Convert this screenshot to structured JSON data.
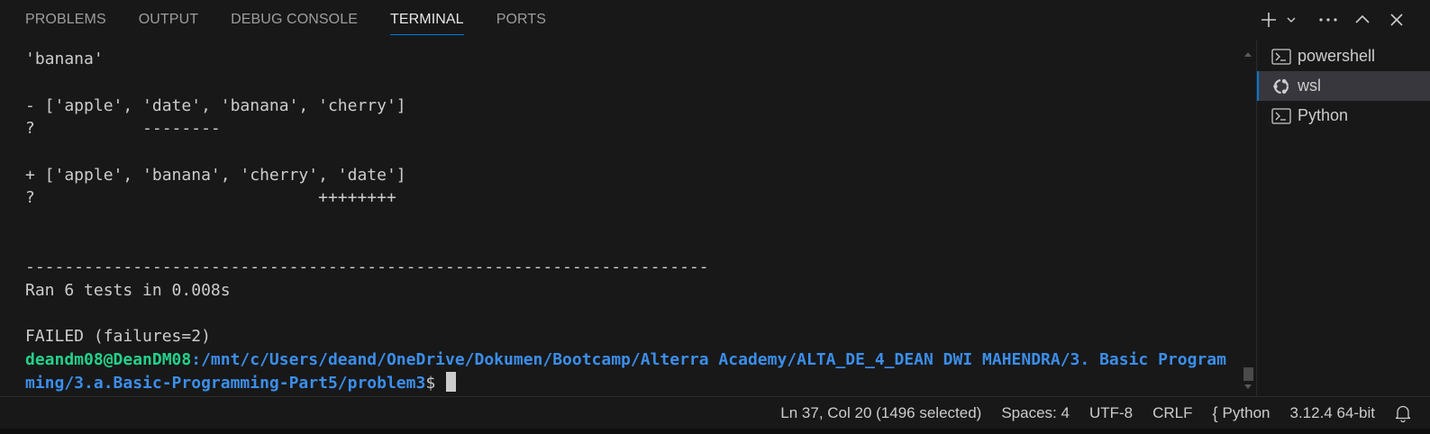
{
  "tabs": [
    {
      "label": "PROBLEMS"
    },
    {
      "label": "OUTPUT"
    },
    {
      "label": "DEBUG CONSOLE"
    },
    {
      "label": "TERMINAL"
    },
    {
      "label": "PORTS"
    }
  ],
  "header_actions": [
    "add-icon",
    "chevron-down-icon",
    "more-icon",
    "chevron-up-icon",
    "close-icon"
  ],
  "terminal": {
    "lines": [
      "'banana'",
      "",
      "- ['apple', 'date', 'banana', 'cherry']",
      "?           --------",
      "",
      "+ ['apple', 'banana', 'cherry', 'date']",
      "?                             ++++++++",
      "",
      "",
      "----------------------------------------------------------------------",
      "Ran 6 tests in 0.008s",
      "",
      "FAILED (failures=2)"
    ],
    "prompt_user": "deandm08@DeanDM08",
    "prompt_path_1": ":/mnt/c/Users/deand/OneDrive/Dokumen/Bootcamp/Alterra Academy/ALTA_DE_4_DEAN DWI MAHENDRA/3. Basic Program",
    "prompt_path_2": "ming/3.a.Basic-Programming-Part5/problem3",
    "prompt_symbol": "$ "
  },
  "terminal_list": [
    {
      "label": "powershell",
      "icon": "terminal-icon"
    },
    {
      "label": "wsl",
      "icon": "linux-icon"
    },
    {
      "label": "Python",
      "icon": "terminal-icon"
    }
  ],
  "status_bar": {
    "position": "Ln 37, Col 20 (1496 selected)",
    "spaces": "Spaces: 4",
    "encoding": "UTF-8",
    "eol": "CRLF",
    "language_braces": "{",
    "language": "Python",
    "interpreter": "3.12.4 64-bit"
  },
  "colors": {
    "accent": "#0078d4",
    "prompt_user": "#23d18b",
    "prompt_path": "#3b8eea",
    "background": "#181818"
  }
}
